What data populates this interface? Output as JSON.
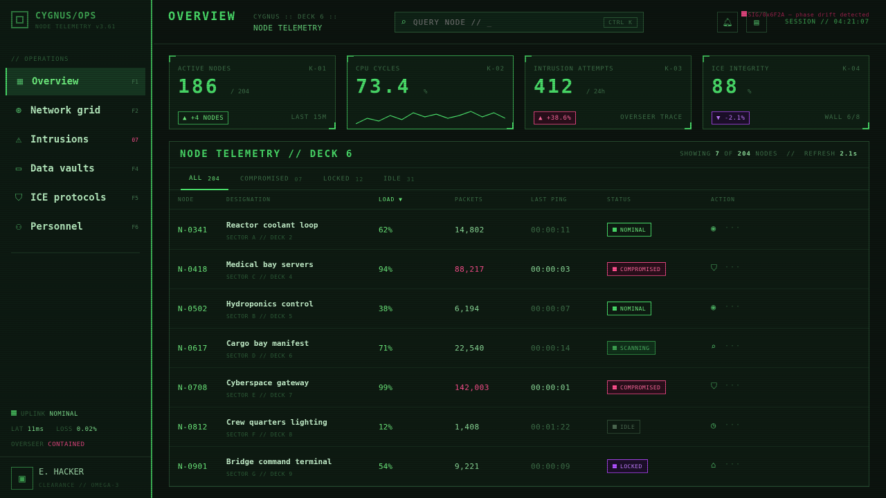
{
  "brand": {
    "title": "CYGNUS/OPS",
    "subtitle": "NODE TELEMETRY v3.61"
  },
  "sidebar": {
    "section_label": "// OPERATIONS",
    "items": [
      {
        "label": "Overview",
        "key": "F1",
        "icon": "grid-icon"
      },
      {
        "label": "Network grid",
        "key": "F2",
        "icon": "globe-icon"
      },
      {
        "label": "Intrusions",
        "key": "07",
        "icon": "warning-icon"
      },
      {
        "label": "Data vaults",
        "key": "F4",
        "icon": "vault-icon"
      },
      {
        "label": "ICE protocols",
        "key": "F5",
        "icon": "shield-icon"
      },
      {
        "label": "Personnel",
        "key": "F6",
        "icon": "person-icon"
      }
    ],
    "status": {
      "uplink_label": "UPLINK",
      "uplink_value": "NOMINAL",
      "lat_label": "LAT",
      "lat_value": "11ms",
      "loss_label": "LOSS",
      "loss_value": "0.02%",
      "overseer_label": "OVERSEER",
      "overseer_value": "CONTAINED"
    },
    "user": {
      "name": "E. HACKER",
      "clearance": "CLEARANCE // OMEGA-3"
    }
  },
  "header": {
    "title": "OVERVIEW",
    "breadcrumb_top": "CYGNUS :: DECK 6 ::",
    "breadcrumb_bottom": "NODE TELEMETRY",
    "search_placeholder": "QUERY NODE // _",
    "search_shortcut": "CTRL K",
    "signal": "SIG/0x6F2A — phase drift detected",
    "session": "SESSION // 04:21:07"
  },
  "stats": [
    {
      "label": "ACTIVE NODES",
      "code": "K-01",
      "value": "186",
      "unit": "/ 204",
      "chip": "▲ +4 NODES",
      "foot": "LAST 15M"
    },
    {
      "label": "CPU CYCLES",
      "code": "K-02",
      "value": "73.4",
      "unit": "%",
      "sparkline": [
        18,
        22,
        20,
        24,
        21,
        26,
        23,
        25,
        22,
        24,
        27,
        23,
        26,
        22
      ]
    },
    {
      "label": "INTRUSION ATTEMPTS",
      "code": "K-03",
      "value": "412",
      "unit": "/ 24h",
      "chip": "▲ +38.6%",
      "foot": "OVERSEER TRACE"
    },
    {
      "label": "ICE INTEGRITY",
      "code": "K-04",
      "value": "88",
      "unit": "%",
      "chip": "▼ -2.1%",
      "foot": "WALL 6/8"
    }
  ],
  "panel": {
    "title": "NODE TELEMETRY // DECK 6",
    "showing_prefix": "SHOWING",
    "showing_count": "7",
    "showing_of": "OF",
    "showing_total": "204",
    "showing_suffix": "NODES",
    "refresh_label": "REFRESH",
    "refresh_value": "2.1s",
    "tabs": [
      {
        "label": "ALL",
        "count": "204"
      },
      {
        "label": "COMPROMISED",
        "count": "07"
      },
      {
        "label": "LOCKED",
        "count": "12"
      },
      {
        "label": "IDLE",
        "count": "31"
      }
    ],
    "columns": [
      "NODE",
      "DESIGNATION",
      "LOAD ▼",
      "PACKETS",
      "LAST PING",
      "STATUS",
      "ACTION"
    ],
    "rows": [
      {
        "node": "N-0341",
        "name": "Reactor coolant loop",
        "sector": "SECTOR A // DECK 2",
        "load": "62%",
        "packets": "14,802",
        "ping": "00:00:11",
        "status": "NOMINAL",
        "action": "◉",
        "more": "···"
      },
      {
        "node": "N-0418",
        "name": "Medical bay servers",
        "sector": "SECTOR C // DECK 4",
        "load": "94%",
        "packets": "88,217",
        "ping": "00:00:03",
        "status": "COMPROMISED",
        "action": "⛉",
        "more": "···"
      },
      {
        "node": "N-0502",
        "name": "Hydroponics control",
        "sector": "SECTOR B // DECK 5",
        "load": "38%",
        "packets": "6,194",
        "ping": "00:00:07",
        "status": "NOMINAL",
        "action": "◉",
        "more": "···"
      },
      {
        "node": "N-0617",
        "name": "Cargo bay manifest",
        "sector": "SECTOR D // DECK 6",
        "load": "71%",
        "packets": "22,540",
        "ping": "00:00:14",
        "status": "SCANNING",
        "action": "⌕",
        "more": "···"
      },
      {
        "node": "N-0708",
        "name": "Cyberspace gateway",
        "sector": "SECTOR E // DECK 7",
        "load": "99%",
        "packets": "142,003",
        "ping": "00:00:01",
        "status": "COMPROMISED",
        "action": "⛉",
        "more": "···"
      },
      {
        "node": "N-0812",
        "name": "Crew quarters lighting",
        "sector": "SECTOR F // DECK 8",
        "load": "12%",
        "packets": "1,408",
        "ping": "00:01:22",
        "status": "IDLE",
        "action": "◷",
        "more": "···"
      },
      {
        "node": "N-0901",
        "name": "Bridge command terminal",
        "sector": "SECTOR G // DECK 9",
        "load": "54%",
        "packets": "9,221",
        "ping": "00:00:09",
        "status": "LOCKED",
        "action": "⌂",
        "more": "···"
      }
    ]
  }
}
